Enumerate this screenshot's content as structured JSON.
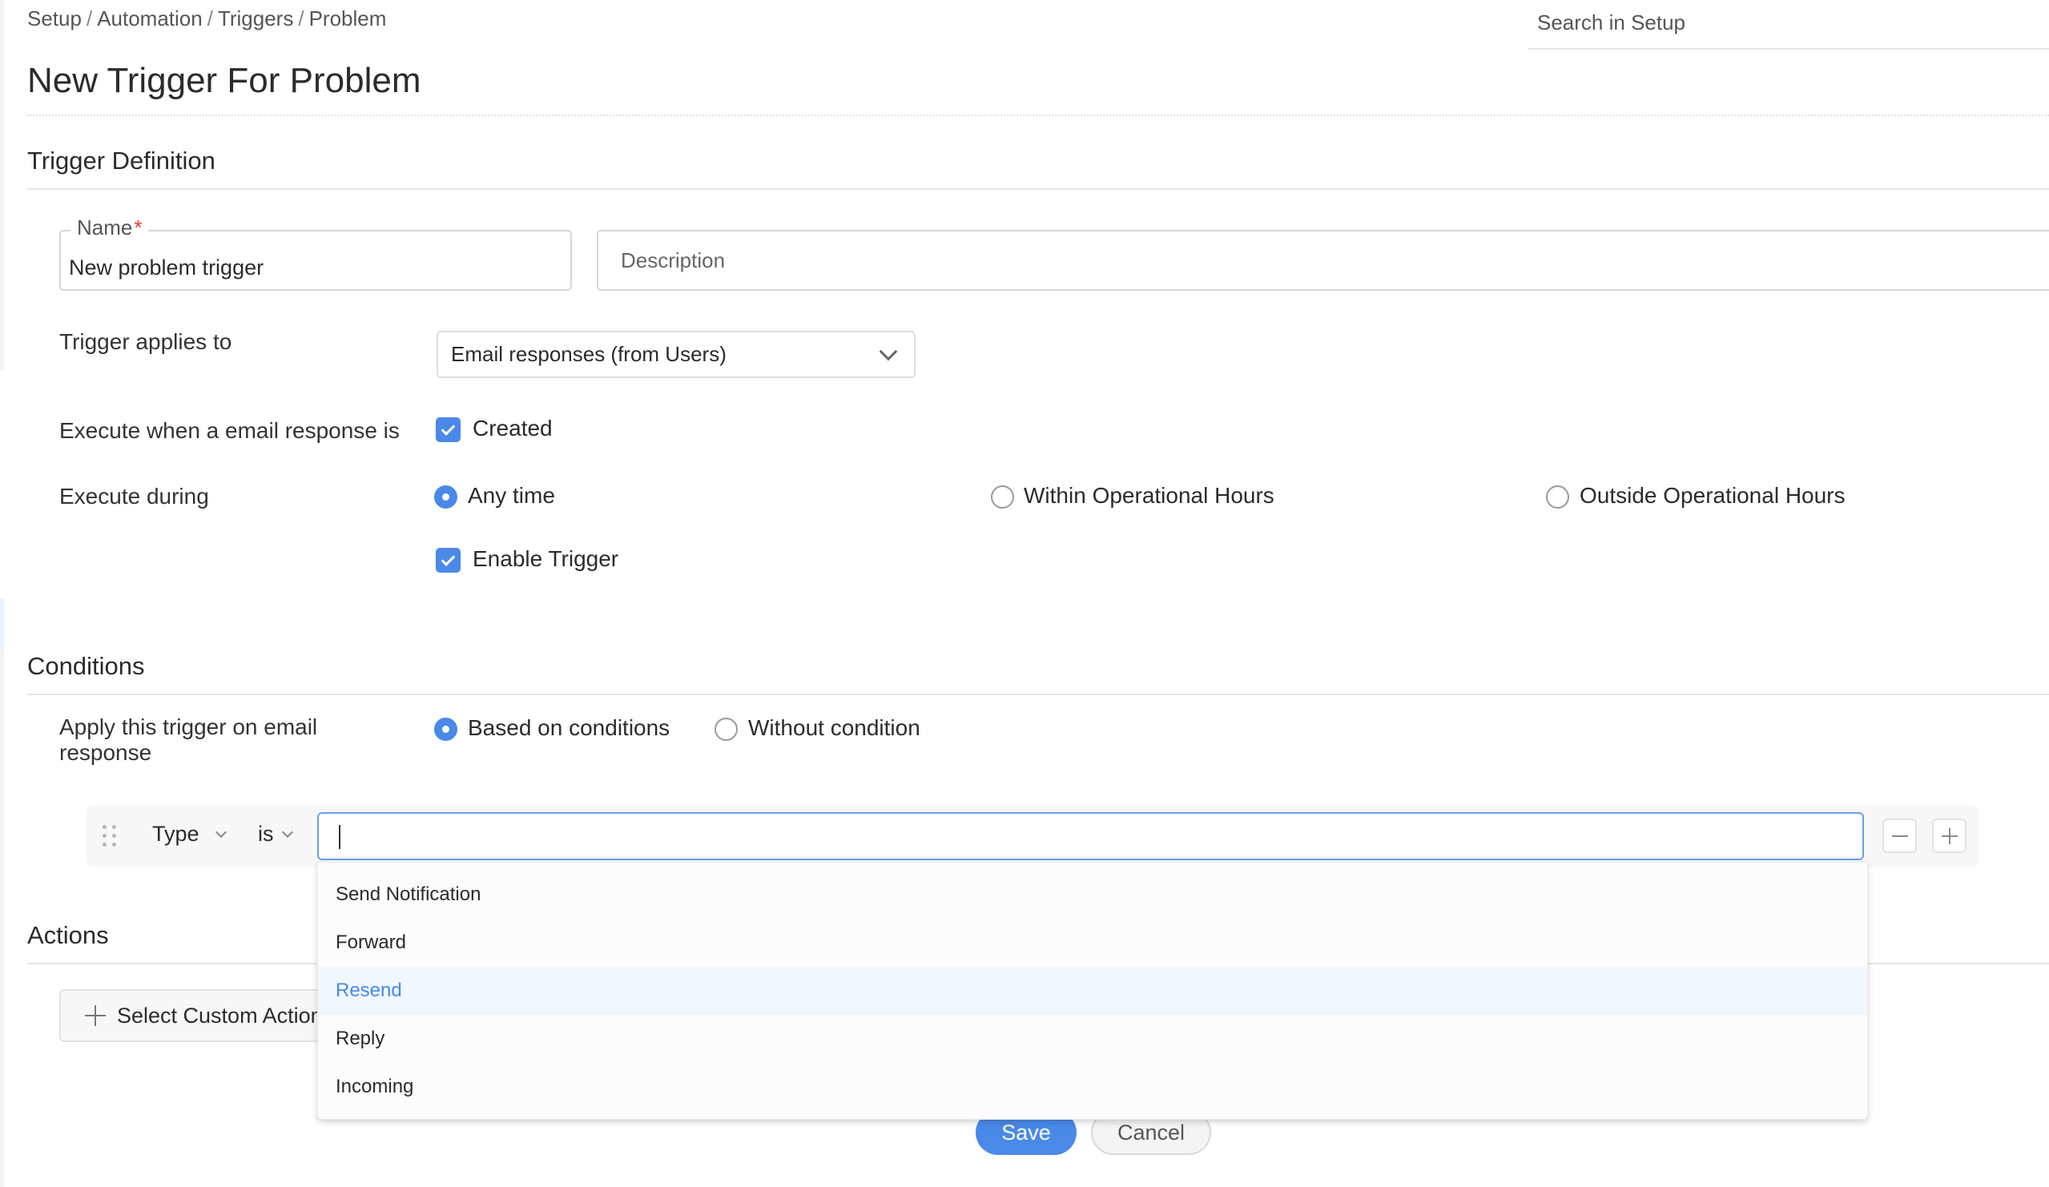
{
  "breadcrumb": [
    "Setup",
    "Automation",
    "Triggers",
    "Problem"
  ],
  "breadcrumb_separator": "/",
  "search": {
    "placeholder": "Search in Setup",
    "value": ""
  },
  "page_title": "New Trigger For Problem",
  "trigger_definition": {
    "title": "Trigger Definition",
    "name": {
      "label": "Name",
      "required_marker": "*",
      "value": "New problem trigger"
    },
    "description": {
      "placeholder": "Description",
      "value": ""
    },
    "applies_to": {
      "label": "Trigger applies to",
      "selected": "Email responses (from Users)"
    },
    "execute_when": {
      "label": "Execute when a email response is",
      "options": [
        {
          "label": "Created",
          "checked": true
        }
      ]
    },
    "execute_during": {
      "label": "Execute during",
      "options": [
        {
          "label": "Any time",
          "selected": true
        },
        {
          "label": "Within Operational Hours",
          "selected": false
        },
        {
          "label": "Outside Operational Hours",
          "selected": false
        }
      ]
    },
    "enable_trigger": {
      "label": "Enable Trigger",
      "checked": true
    }
  },
  "conditions": {
    "title": "Conditions",
    "apply_label": "Apply this trigger on email response",
    "apply_label_line1": "Apply this trigger on email",
    "apply_label_line2": "response",
    "apply_options": [
      {
        "label": "Based on conditions",
        "selected": true
      },
      {
        "label": "Without condition",
        "selected": false
      }
    ],
    "rule": {
      "field": "Type",
      "operator": "is",
      "value": "",
      "dropdown_options": [
        "Send Notification",
        "Forward",
        "Resend",
        "Reply",
        "Incoming"
      ],
      "highlighted_option": "Resend"
    }
  },
  "actions": {
    "title": "Actions",
    "select_custom_action_label": "Select Custom Action"
  },
  "footer": {
    "save_label": "Save",
    "cancel_label": "Cancel"
  },
  "colors": {
    "accent": "#4a89e8",
    "required": "#e53935",
    "highlight_bg": "#f0f7ff"
  }
}
